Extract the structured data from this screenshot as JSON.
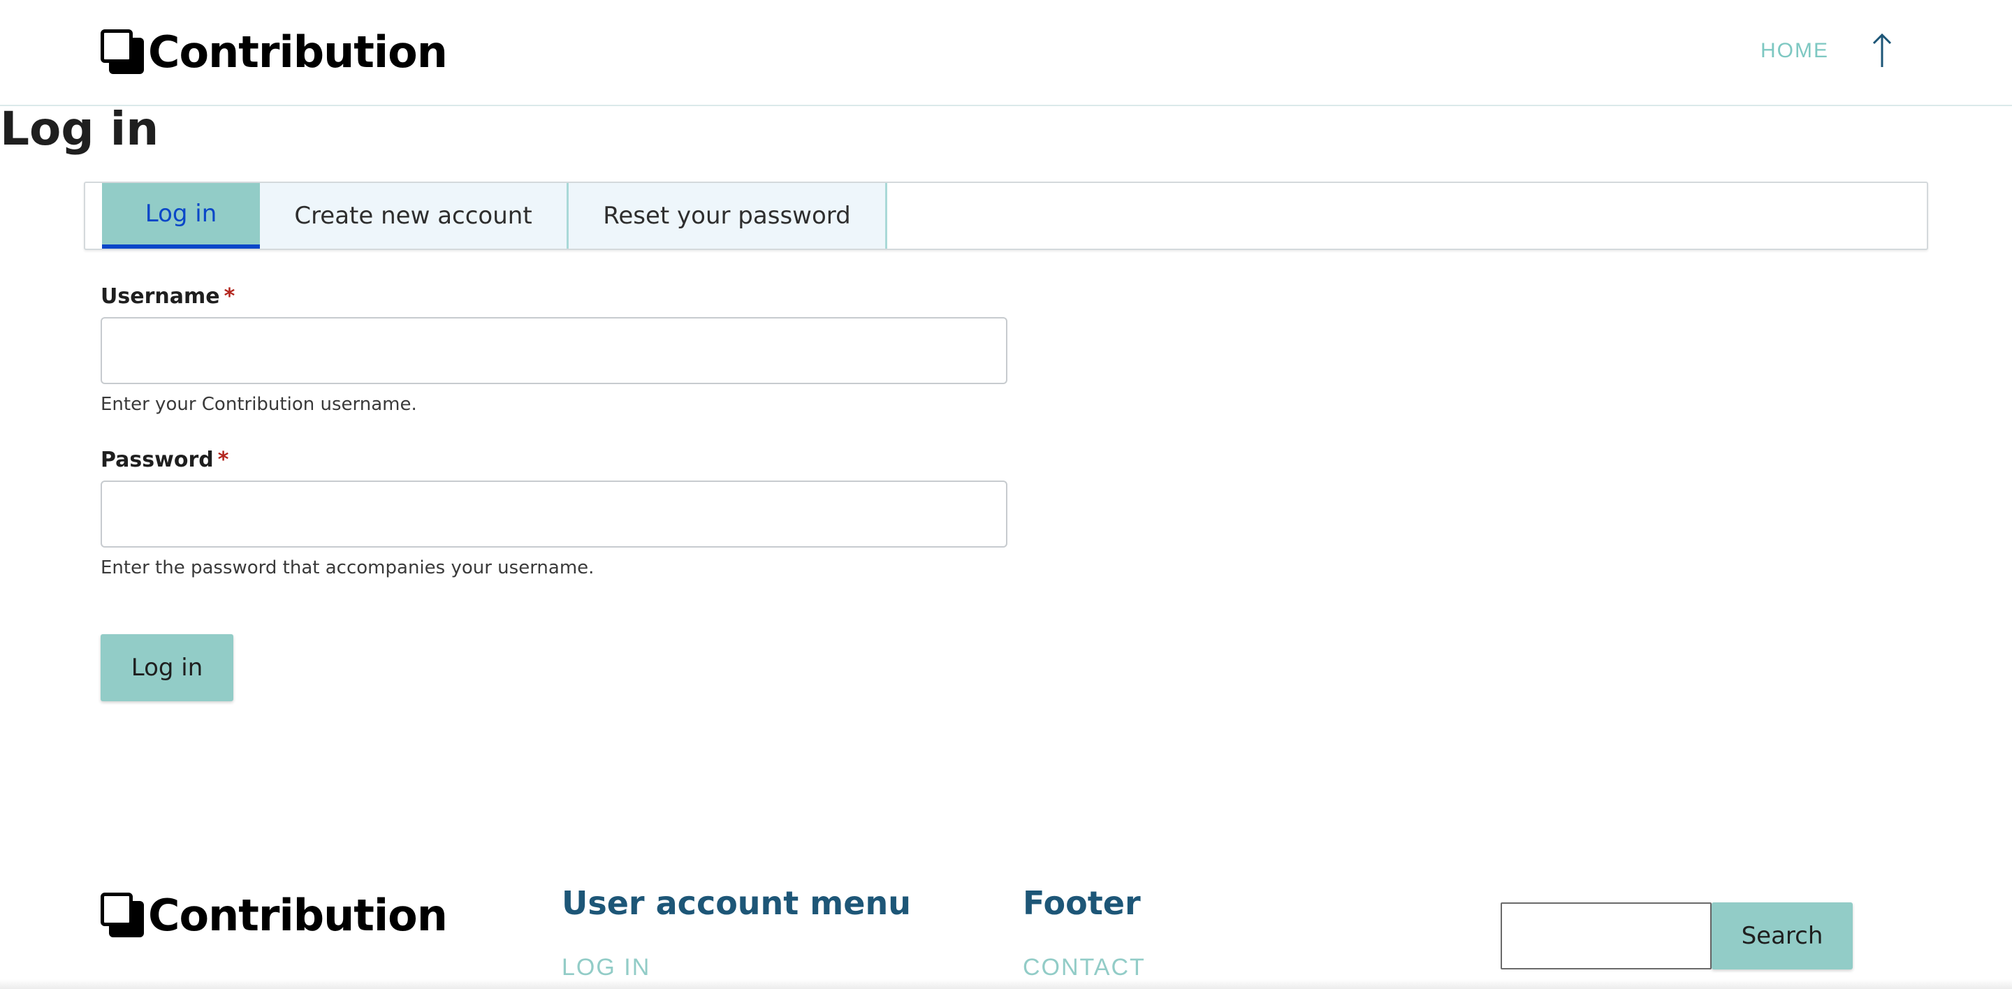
{
  "colors": {
    "accent_teal": "#92ccc7",
    "link_teal": "#7ec8c2",
    "active_tab_text": "#0a47c8",
    "footer_heading": "#1d5677",
    "required": "#b3261e"
  },
  "header": {
    "logo_text": "Contribution",
    "nav_home": "HOME",
    "back_to_top_icon": "arrow-up-icon"
  },
  "page": {
    "title": "Log in"
  },
  "tabs": [
    {
      "label": "Log in",
      "active": true
    },
    {
      "label": "Create new account",
      "active": false
    },
    {
      "label": "Reset your password",
      "active": false
    }
  ],
  "form": {
    "username": {
      "label": "Username",
      "required_mark": "*",
      "value": "",
      "description": "Enter your Contribution username."
    },
    "password": {
      "label": "Password",
      "required_mark": "*",
      "value": "",
      "description": "Enter the password that accompanies your username."
    },
    "submit_label": "Log in"
  },
  "footer": {
    "logo_text": "Contribution",
    "user_menu": {
      "title": "User account menu",
      "items": [
        "LOG IN"
      ]
    },
    "footer_menu": {
      "title": "Footer",
      "items": [
        "CONTACT"
      ]
    },
    "search": {
      "value": "",
      "button_label": "Search"
    }
  }
}
